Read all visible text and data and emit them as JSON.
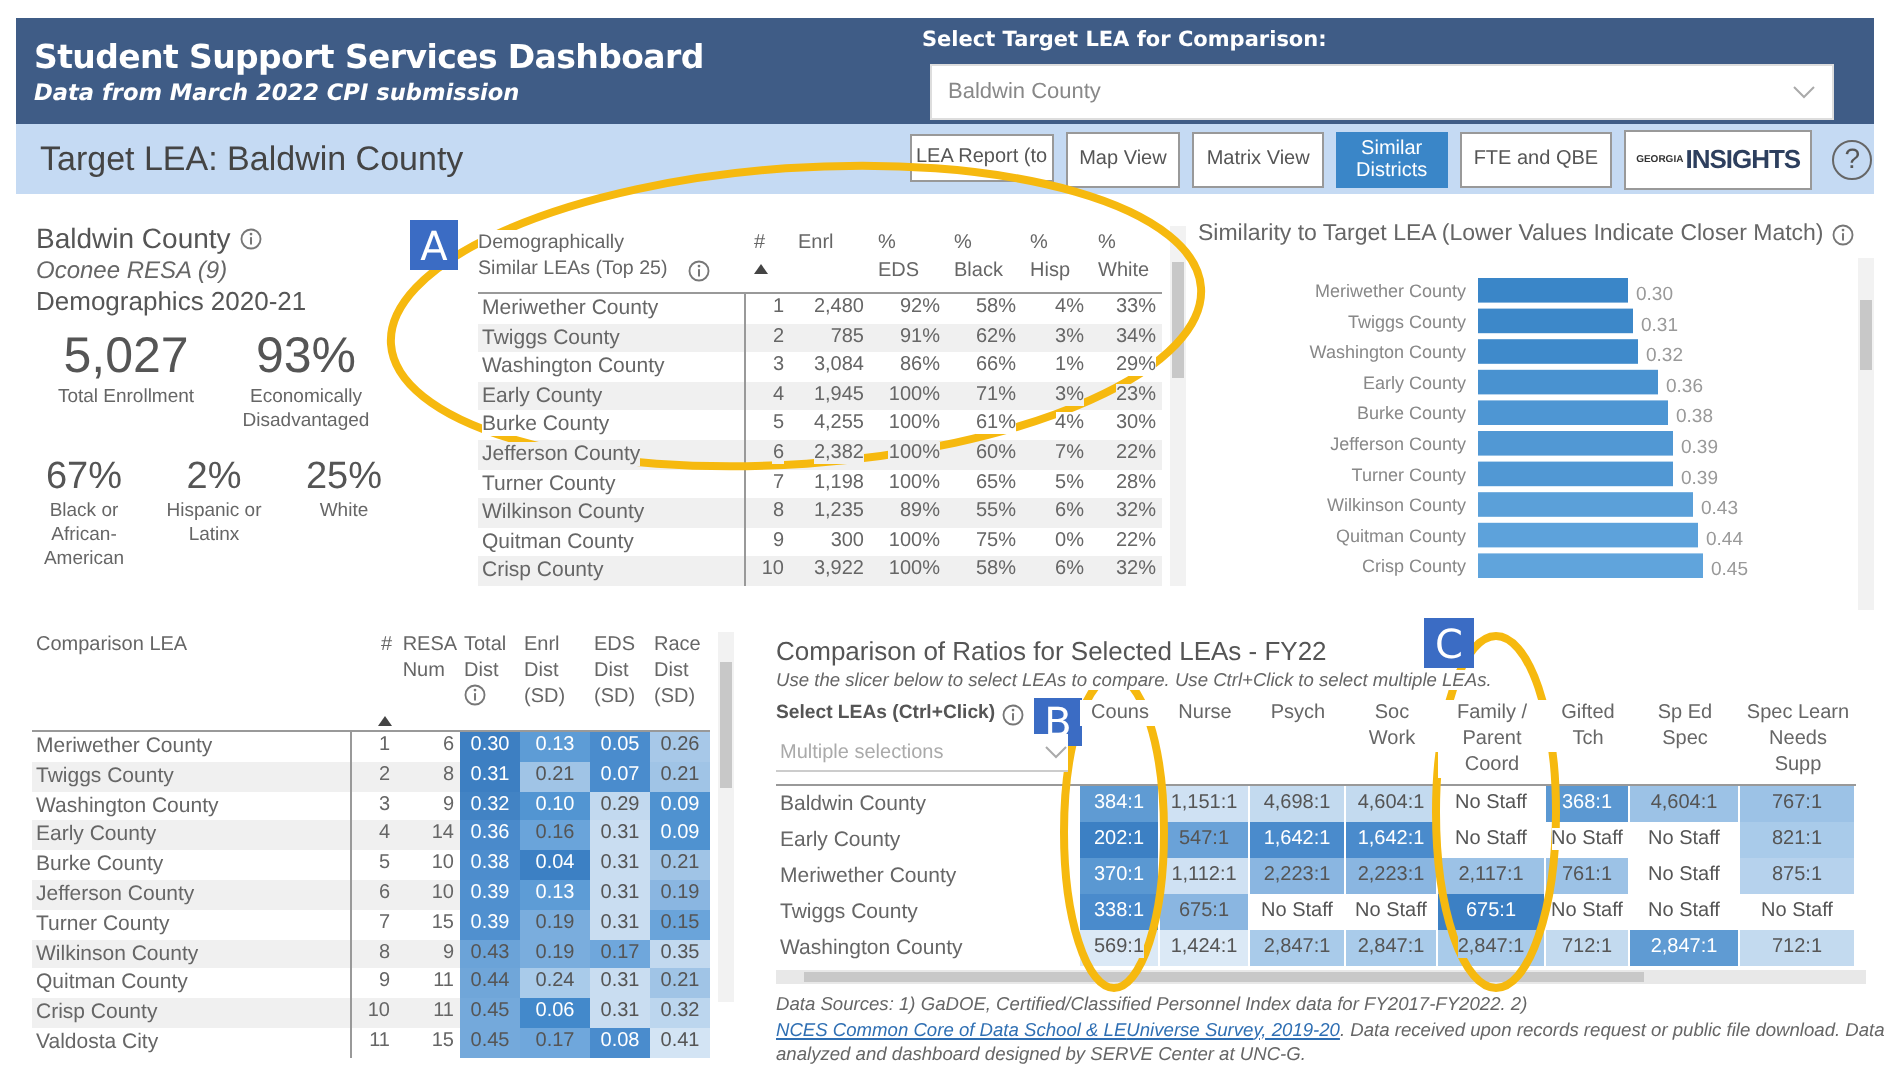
{
  "header": {
    "title": "Student Support Services Dashboard",
    "subtitle": "Data from March 2022 CPI submission",
    "selector_label": "Select Target LEA for Comparison:",
    "selector_value": "Baldwin County"
  },
  "target_bar": {
    "label": "Target LEA: Baldwin County",
    "buttons": [
      {
        "label": "LEA Report (to",
        "selected": false
      },
      {
        "label": "Map View",
        "selected": false
      },
      {
        "label": "Matrix View",
        "selected": false
      },
      {
        "label": "Similar Districts",
        "selected": true
      },
      {
        "label": "FTE and QBE",
        "selected": false
      }
    ],
    "logo": {
      "small": "GEORGIA",
      "big": "INSIGHTS"
    },
    "help": "?"
  },
  "summary": {
    "title": "Baldwin County",
    "resa": "Oconee RESA (9)",
    "demographics": "Demographics 2020-21",
    "stats": [
      {
        "value": "5,027",
        "label": "Total Enrollment"
      },
      {
        "value": "93%",
        "label": "Economically Disadvantaged"
      },
      {
        "value": "67%",
        "label": "Black or African-American"
      },
      {
        "value": "2%",
        "label": "Hispanic or Latinx"
      },
      {
        "value": "25%",
        "label": "White"
      }
    ]
  },
  "similar_table": {
    "columns": [
      "Demographically Similar LEAs (Top 25)",
      "#",
      "Enrl",
      "% EDS",
      "% Black",
      "% Hisp",
      "% White"
    ],
    "rows": [
      [
        "Meriwether County",
        "1",
        "2,480",
        "92%",
        "58%",
        "4%",
        "33%"
      ],
      [
        "Twiggs County",
        "2",
        "785",
        "91%",
        "62%",
        "3%",
        "34%"
      ],
      [
        "Washington County",
        "3",
        "3,084",
        "86%",
        "66%",
        "1%",
        "29%"
      ],
      [
        "Early County",
        "4",
        "1,945",
        "100%",
        "71%",
        "3%",
        "23%"
      ],
      [
        "Burke County",
        "5",
        "4,255",
        "100%",
        "61%",
        "4%",
        "30%"
      ],
      [
        "Jefferson County",
        "6",
        "2,382",
        "100%",
        "60%",
        "7%",
        "22%"
      ],
      [
        "Turner County",
        "7",
        "1,198",
        "100%",
        "65%",
        "5%",
        "28%"
      ],
      [
        "Wilkinson County",
        "8",
        "1,235",
        "89%",
        "55%",
        "6%",
        "32%"
      ],
      [
        "Quitman County",
        "9",
        "300",
        "100%",
        "75%",
        "0%",
        "22%"
      ],
      [
        "Crisp County",
        "10",
        "3,922",
        "100%",
        "58%",
        "6%",
        "32%"
      ]
    ]
  },
  "similarity": {
    "title": "Similarity to Target LEA (Lower Values Indicate Closer Match)",
    "chart_data": {
      "type": "bar",
      "orientation": "horizontal",
      "value_labels": [
        "0.30",
        "0.31",
        "0.32",
        "0.36",
        "0.38",
        "0.39",
        "0.39",
        "0.43",
        "0.44",
        "0.45"
      ],
      "categories": [
        "Meriwether County",
        "Twiggs County",
        "Washington County",
        "Early County",
        "Burke County",
        "Jefferson County",
        "Turner County",
        "Wilkinson County",
        "Quitman County",
        "Crisp County"
      ],
      "values": [
        0.3,
        0.31,
        0.32,
        0.36,
        0.38,
        0.39,
        0.39,
        0.43,
        0.44,
        0.45
      ]
    }
  },
  "distance_table": {
    "columns": [
      "Comparison LEA",
      "#",
      "RESA Num",
      "Total Dist",
      "Enrl Dist (SD)",
      "EDS Dist (SD)",
      "Race Dist (SD)"
    ],
    "rows": [
      {
        "name": "Meriwether County",
        "rank": "1",
        "resa": "6",
        "dists": [
          {
            "text": "0.30",
            "color": "#3d7fc2"
          },
          {
            "text": "0.13",
            "color": "#5d9cd6"
          },
          {
            "text": "0.05",
            "color": "#4a8ccd"
          },
          {
            "text": "0.26",
            "color": "#a7c8e8"
          }
        ]
      },
      {
        "name": "Twiggs County",
        "rank": "2",
        "resa": "8",
        "dists": [
          {
            "text": "0.31",
            "color": "#3d7fc2"
          },
          {
            "text": "0.21",
            "color": "#a0c4e6"
          },
          {
            "text": "0.07",
            "color": "#4a8ccd"
          },
          {
            "text": "0.21",
            "color": "#a0c4e6"
          }
        ]
      },
      {
        "name": "Washington County",
        "rank": "3",
        "resa": "9",
        "dists": [
          {
            "text": "0.32",
            "color": "#4283c4"
          },
          {
            "text": "0.10",
            "color": "#5295d2"
          },
          {
            "text": "0.29",
            "color": "#c2d9ef"
          },
          {
            "text": "0.09",
            "color": "#4f92d0"
          }
        ]
      },
      {
        "name": "Early County",
        "rank": "4",
        "resa": "14",
        "dists": [
          {
            "text": "0.36",
            "color": "#4a8acb"
          },
          {
            "text": "0.16",
            "color": "#6aa4da"
          },
          {
            "text": "0.31",
            "color": "#c9ddf1"
          },
          {
            "text": "0.09",
            "color": "#4f92d0"
          }
        ]
      },
      {
        "name": "Burke County",
        "rank": "5",
        "resa": "10",
        "dists": [
          {
            "text": "0.38",
            "color": "#4d8dcd"
          },
          {
            "text": "0.04",
            "color": "#3c80c4"
          },
          {
            "text": "0.31",
            "color": "#c9ddf1"
          },
          {
            "text": "0.21",
            "color": "#a0c4e6"
          }
        ]
      },
      {
        "name": "Jefferson County",
        "rank": "6",
        "resa": "10",
        "dists": [
          {
            "text": "0.39",
            "color": "#5090cf"
          },
          {
            "text": "0.13",
            "color": "#5d9cd6"
          },
          {
            "text": "0.31",
            "color": "#c9ddf1"
          },
          {
            "text": "0.19",
            "color": "#8ab6e1"
          }
        ]
      },
      {
        "name": "Turner County",
        "rank": "7",
        "resa": "15",
        "dists": [
          {
            "text": "0.39",
            "color": "#5090cf"
          },
          {
            "text": "0.19",
            "color": "#7aaddd"
          },
          {
            "text": "0.31",
            "color": "#c9ddf1"
          },
          {
            "text": "0.15",
            "color": "#6aa4da"
          }
        ]
      },
      {
        "name": "Wilkinson County",
        "rank": "8",
        "resa": "9",
        "dists": [
          {
            "text": "0.43",
            "color": "#6ba3d8"
          },
          {
            "text": "0.19",
            "color": "#7aaddd"
          },
          {
            "text": "0.17",
            "color": "#6fa7dc"
          },
          {
            "text": "0.35",
            "color": "#c2d9ef"
          }
        ]
      },
      {
        "name": "Quitman County",
        "rank": "9",
        "resa": "11",
        "dists": [
          {
            "text": "0.44",
            "color": "#70a6d9"
          },
          {
            "text": "0.24",
            "color": "#a9cbea"
          },
          {
            "text": "0.31",
            "color": "#c9ddf1"
          },
          {
            "text": "0.21",
            "color": "#a0c4e6"
          }
        ]
      },
      {
        "name": "Crisp County",
        "rank": "10",
        "resa": "11",
        "dists": [
          {
            "text": "0.45",
            "color": "#74a9db"
          },
          {
            "text": "0.06",
            "color": "#4389cb"
          },
          {
            "text": "0.31",
            "color": "#c9ddf1"
          },
          {
            "text": "0.32",
            "color": "#bcd6ee"
          }
        ]
      },
      {
        "name": "Valdosta City",
        "rank": "11",
        "resa": "15",
        "dists": [
          {
            "text": "0.45",
            "color": "#74a9db"
          },
          {
            "text": "0.17",
            "color": "#6fa7dc"
          },
          {
            "text": "0.08",
            "color": "#4a8ccd"
          },
          {
            "text": "0.41",
            "color": "#d3e4f4"
          }
        ]
      }
    ]
  },
  "ratios": {
    "title": "Comparison of Ratios for Selected LEAs - FY22",
    "instruction": "Use the slicer below to select LEAs to compare. Use Ctrl+Click to select multiple LEAs.",
    "slicer_label": "Select LEAs (Ctrl+Click)",
    "slicer_placeholder": "Multiple selections",
    "columns": [
      "Couns",
      "Nurse",
      "Psych",
      "Soc Work",
      "Family / Parent Coord",
      "Gifted Tch",
      "Sp Ed Spec",
      "Spec Learn Needs Supp"
    ],
    "rows": [
      {
        "name": "Baldwin County",
        "cells": [
          {
            "text": "384:1",
            "color": "#5f9bd3"
          },
          {
            "text": "1,151:1",
            "color": "#cfe1f3"
          },
          {
            "text": "4,698:1",
            "color": "#c3daef"
          },
          {
            "text": "4,604:1",
            "color": "#c3daef"
          },
          {
            "text": "No Staff",
            "color": "#ffffff"
          },
          {
            "text": "368:1",
            "color": "#5b98d2"
          },
          {
            "text": "4,604:1",
            "color": "#9cc2e6"
          },
          {
            "text": "767:1",
            "color": "#9cc2e6"
          }
        ]
      },
      {
        "name": "Early County",
        "cells": [
          {
            "text": "202:1",
            "color": "#3c80c4"
          },
          {
            "text": "547:1",
            "color": "#6aa2d8"
          },
          {
            "text": "1,642:1",
            "color": "#4a8bcc"
          },
          {
            "text": "1,642:1",
            "color": "#4a8bcc"
          },
          {
            "text": "No Staff",
            "color": "#ffffff"
          },
          {
            "text": "No Staff",
            "color": "#ffffff"
          },
          {
            "text": "No Staff",
            "color": "#ffffff"
          },
          {
            "text": "821:1",
            "color": "#a9cbea"
          }
        ]
      },
      {
        "name": "Meriwether County",
        "cells": [
          {
            "text": "370:1",
            "color": "#5a98d2"
          },
          {
            "text": "1,112:1",
            "color": "#cfe1f3"
          },
          {
            "text": "2,223:1",
            "color": "#8ab6e1"
          },
          {
            "text": "2,223:1",
            "color": "#8ab6e1"
          },
          {
            "text": "2,117:1",
            "color": "#9cc2e6"
          },
          {
            "text": "761:1",
            "color": "#9cc2e6"
          },
          {
            "text": "No Staff",
            "color": "#ffffff"
          },
          {
            "text": "875:1",
            "color": "#b6d2ed"
          }
        ]
      },
      {
        "name": "Twiggs County",
        "cells": [
          {
            "text": "338:1",
            "color": "#4a8bcc"
          },
          {
            "text": "675:1",
            "color": "#8ab6e1"
          },
          {
            "text": "No Staff",
            "color": "#ffffff"
          },
          {
            "text": "No Staff",
            "color": "#ffffff"
          },
          {
            "text": "675:1",
            "color": "#3c80c4"
          },
          {
            "text": "No Staff",
            "color": "#ffffff"
          },
          {
            "text": "No Staff",
            "color": "#ffffff"
          },
          {
            "text": "No Staff",
            "color": "#ffffff"
          }
        ]
      },
      {
        "name": "Washington County",
        "cells": [
          {
            "text": "569:1",
            "color": "#dbe9f6"
          },
          {
            "text": "1,424:1",
            "color": "#dbe9f6"
          },
          {
            "text": "2,847:1",
            "color": "#a9cbea"
          },
          {
            "text": "2,847:1",
            "color": "#a9cbea"
          },
          {
            "text": "2,847:1",
            "color": "#a9cbea"
          },
          {
            "text": "712:1",
            "color": "#c3daef"
          },
          {
            "text": "2,847:1",
            "color": "#5f9bd3"
          },
          {
            "text": "712:1",
            "color": "#c3daef"
          }
        ]
      }
    ],
    "footnote": [
      {
        "kind": "text",
        "text": "Data Sources: 1) GaDOE, Certified/Classified Personnel Index data for FY2017-FY2022. 2) "
      },
      {
        "kind": "link",
        "text": "NCES Common Core of Data School & LE"
      },
      {
        "kind": "link",
        "text": "Universe Survey, 2019-20"
      },
      {
        "kind": "text",
        "text": ". Data received upon records request or public file download. Data analyzed and dashboard designed by SERVE Center at UNC-G."
      }
    ]
  },
  "annotations": [
    {
      "label": "A"
    },
    {
      "label": "B"
    },
    {
      "label": "C"
    }
  ]
}
